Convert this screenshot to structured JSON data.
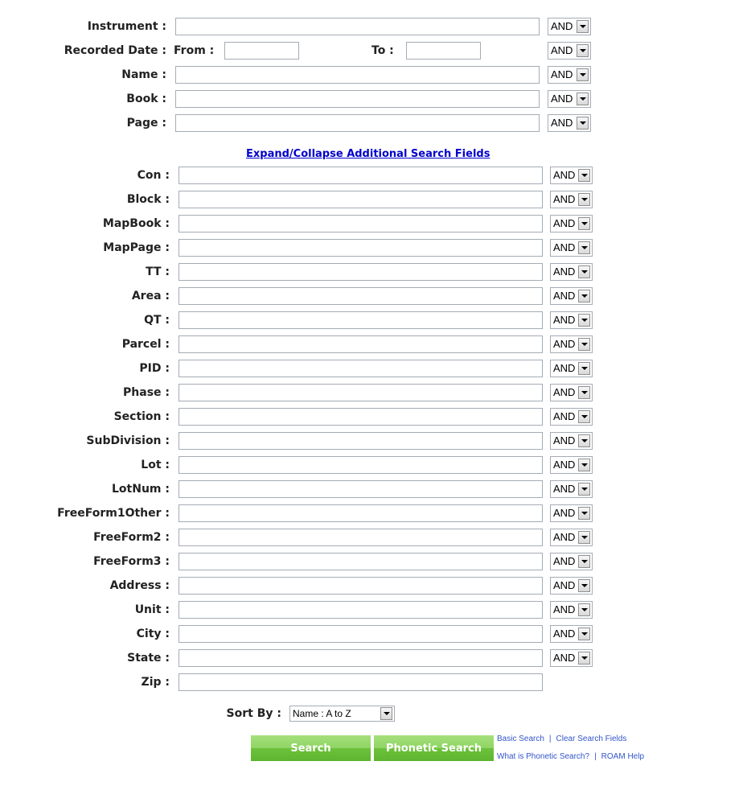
{
  "top_fields": [
    {
      "label": "Instrument :",
      "value": "",
      "operator": "AND"
    },
    {
      "label": "Name :",
      "value": "",
      "operator": "AND"
    },
    {
      "label": "Book :",
      "value": "",
      "operator": "AND"
    },
    {
      "label": "Page :",
      "value": "",
      "operator": "AND"
    }
  ],
  "recorded_date": {
    "label": "Recorded Date :",
    "from_label": "From :",
    "to_label": "To :",
    "from_value": "",
    "to_value": "",
    "operator": "AND"
  },
  "expand_link": "Expand/Collapse Additional Search Fields",
  "additional_fields": [
    {
      "label": "Con :",
      "value": "",
      "operator": "AND"
    },
    {
      "label": "Block :",
      "value": "",
      "operator": "AND"
    },
    {
      "label": "MapBook :",
      "value": "",
      "operator": "AND"
    },
    {
      "label": "MapPage :",
      "value": "",
      "operator": "AND"
    },
    {
      "label": "TT :",
      "value": "",
      "operator": "AND"
    },
    {
      "label": "Area :",
      "value": "",
      "operator": "AND"
    },
    {
      "label": "QT :",
      "value": "",
      "operator": "AND"
    },
    {
      "label": "Parcel :",
      "value": "",
      "operator": "AND"
    },
    {
      "label": "PID :",
      "value": "",
      "operator": "AND"
    },
    {
      "label": "Phase :",
      "value": "",
      "operator": "AND"
    },
    {
      "label": "Section :",
      "value": "",
      "operator": "AND"
    },
    {
      "label": "SubDivision :",
      "value": "",
      "operator": "AND"
    },
    {
      "label": "Lot :",
      "value": "",
      "operator": "AND"
    },
    {
      "label": "LotNum :",
      "value": "",
      "operator": "AND"
    },
    {
      "label": "FreeForm1Other :",
      "value": "",
      "operator": "AND"
    },
    {
      "label": "FreeForm2 :",
      "value": "",
      "operator": "AND"
    },
    {
      "label": "FreeForm3 :",
      "value": "",
      "operator": "AND"
    },
    {
      "label": "Address :",
      "value": "",
      "operator": "AND"
    },
    {
      "label": "Unit :",
      "value": "",
      "operator": "AND"
    },
    {
      "label": "City :",
      "value": "",
      "operator": "AND"
    },
    {
      "label": "State :",
      "value": "",
      "operator": "AND"
    },
    {
      "label": "Zip :",
      "value": "",
      "operator": null
    }
  ],
  "sort": {
    "label": "Sort By :",
    "selected": "Name : A to Z"
  },
  "buttons": {
    "search": "Search",
    "phonetic_search": "Phonetic Search"
  },
  "links": {
    "basic_search": "Basic Search",
    "clear_search_fields": "Clear Search Fields",
    "what_is_phonetic": "What is Phonetic Search?",
    "roam_help": "ROAM Help",
    "separator": "|"
  },
  "colors": {
    "link": "#0000cc",
    "small_link": "#3355cc",
    "button_green": "#6cc23b"
  }
}
